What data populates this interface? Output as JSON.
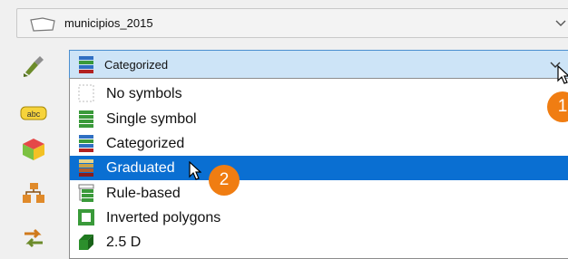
{
  "layer": {
    "name": "municipios_2015"
  },
  "renderer": {
    "selected": "Categorized",
    "options": [
      {
        "label": "No symbols",
        "icon": "no-symbols-icon"
      },
      {
        "label": "Single symbol",
        "icon": "single-symbol-icon"
      },
      {
        "label": "Categorized",
        "icon": "categorized-icon"
      },
      {
        "label": "Graduated",
        "icon": "graduated-icon",
        "highlighted": true
      },
      {
        "label": "Rule-based",
        "icon": "rule-based-icon"
      },
      {
        "label": "Inverted polygons",
        "icon": "inverted-polygons-icon"
      },
      {
        "label": "2.5 D",
        "icon": "two-point-five-d-icon"
      }
    ]
  },
  "side_tabs": [
    {
      "icon": "symbology-brush-icon"
    },
    {
      "icon": "labels-abc-icon"
    },
    {
      "icon": "3d-cube-icon"
    },
    {
      "icon": "diagrams-icon"
    },
    {
      "icon": "actions-arrows-icon"
    }
  ],
  "annotations": {
    "step1": "1",
    "step2": "2"
  },
  "colors": {
    "selection": "#0a6fd2",
    "badge": "#f07d12",
    "combo_focus": "#cde4f7"
  }
}
